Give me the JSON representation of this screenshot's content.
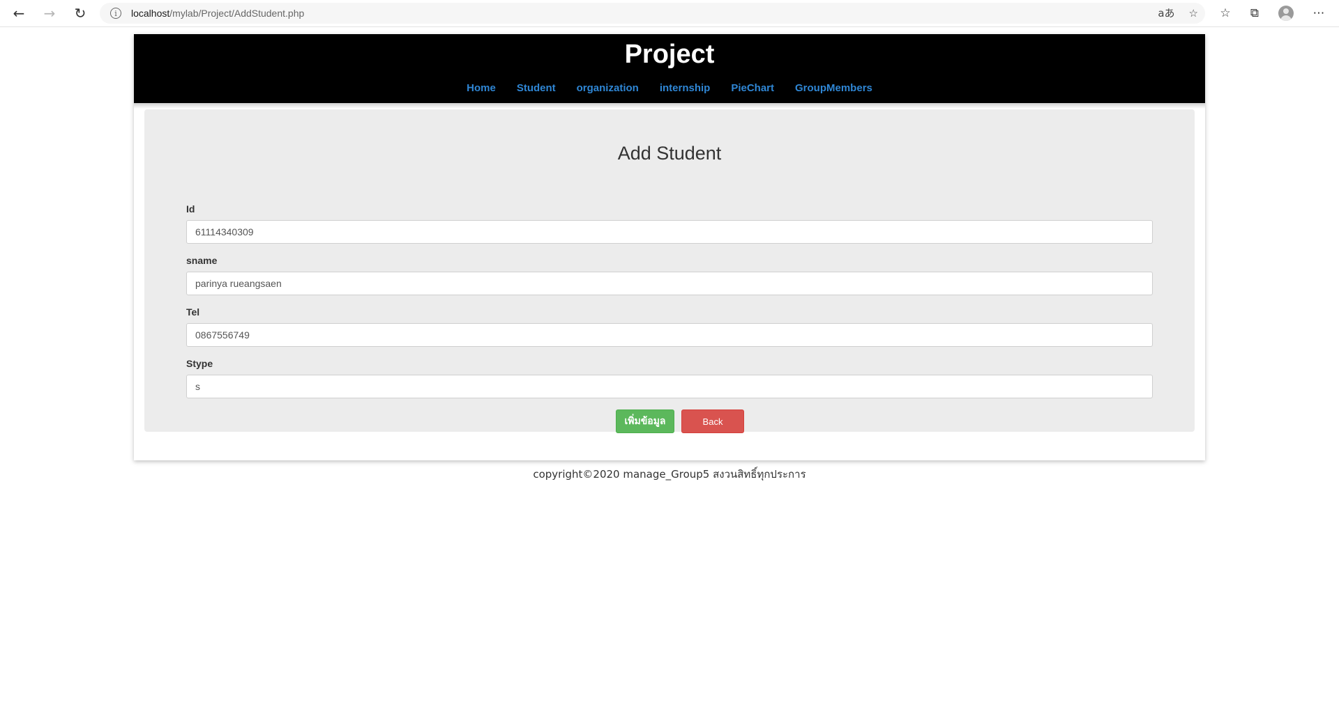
{
  "browser": {
    "url_host": "localhost",
    "url_path": "/mylab/Project/AddStudent.php",
    "read_aloud": "aあ"
  },
  "header": {
    "title": "Project",
    "nav": [
      "Home",
      "Student",
      "organization",
      "internship",
      "PieChart",
      "GroupMembers"
    ]
  },
  "form": {
    "title": "Add Student",
    "fields": [
      {
        "label": "Id",
        "value": "61114340309"
      },
      {
        "label": "sname",
        "value": "parinya rueangsaen"
      },
      {
        "label": "Tel",
        "value": "0867556749"
      },
      {
        "label": "Stype",
        "value": "s"
      }
    ],
    "submit_label": "เพิ่มข้อมูล",
    "back_label": "Back"
  },
  "footer": {
    "text": "copyright©2020 manage_Group5 สงวนสิทธิ์ทุกประการ"
  },
  "colors": {
    "header_bg": "#000000",
    "nav_link": "#2f86d4",
    "card_bg": "#ececec",
    "submit": "#5cb85c",
    "back": "#d9534f"
  }
}
